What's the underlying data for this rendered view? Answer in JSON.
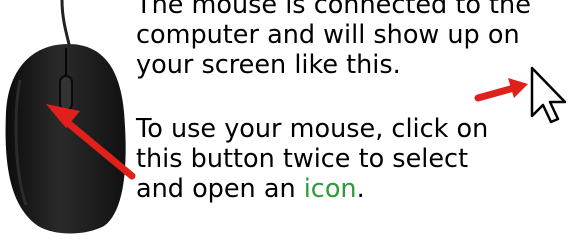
{
  "paragraph_1": {
    "line_1": "The mouse is connected to the",
    "line_2": "computer and will show up on",
    "line_3": "your screen like this."
  },
  "paragraph_2": {
    "line_1": "To use your mouse, click on",
    "line_2": "this button twice to select",
    "line_3_before": "and open an ",
    "line_3_highlight": "icon",
    "line_3_after": "."
  },
  "colors": {
    "arrow": "#e0201b",
    "highlight_word": "#2e9c3a",
    "mouse_body": "#1c1c1c"
  },
  "icons": [
    "computer-mouse-illustration",
    "pointer-cursor-icon",
    "red-arrow-icon"
  ]
}
